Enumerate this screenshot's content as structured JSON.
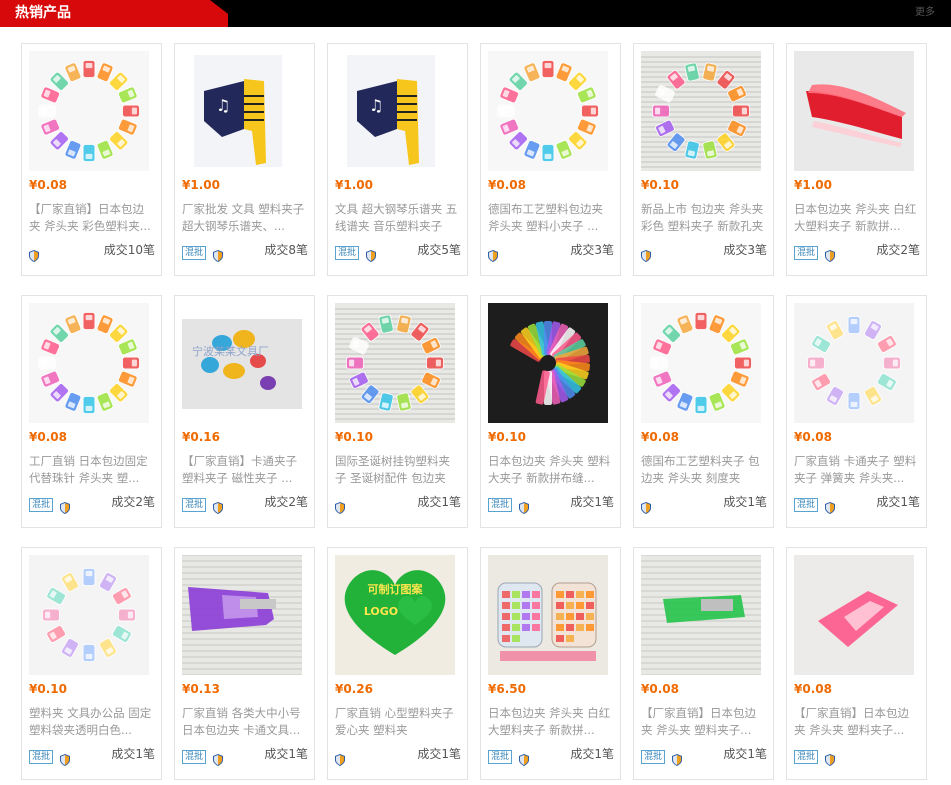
{
  "header": {
    "title": "热销产品",
    "more": "更多"
  },
  "items": [
    {
      "price": "¥0.08",
      "desc": "【厂家直销】日本包边夹 斧头夹 彩色塑料夹...",
      "mixed": false,
      "sold": "成交10笔",
      "img": "rainbow-ring"
    },
    {
      "price": "¥1.00",
      "desc": "厂家批发 文具 塑料夹子 超大钢琴乐谱夹、...",
      "mixed": true,
      "sold": "成交8笔",
      "img": "music-clip"
    },
    {
      "price": "¥1.00",
      "desc": "文具 超大钢琴乐谱夹 五线谱夹 音乐塑料夹子",
      "mixed": true,
      "sold": "成交5笔",
      "img": "music-clip"
    },
    {
      "price": "¥0.08",
      "desc": "德国布工艺塑料包边夹 斧头夹 塑料小夹子 ...",
      "mixed": false,
      "sold": "成交3笔",
      "img": "rainbow-ring"
    },
    {
      "price": "¥0.10",
      "desc": "新品上市 包边夹 斧头夹 彩色 塑料夹子 新款孔夹",
      "mixed": false,
      "sold": "成交3笔",
      "img": "newspaper-ring"
    },
    {
      "price": "¥1.00",
      "desc": "日本包边夹 斧头夹 白红大塑料夹子 新款拼...",
      "mixed": true,
      "sold": "成交2笔",
      "img": "red-clip"
    },
    {
      "price": "¥0.08",
      "desc": "工厂直销 日本包边固定代替珠针 斧头夹 塑...",
      "mixed": true,
      "sold": "成交2笔",
      "img": "rainbow-ring"
    },
    {
      "price": "¥0.16",
      "desc": "【厂家直销】卡通夹子 塑料夹子 磁性夹子 ...",
      "mixed": true,
      "sold": "成交2笔",
      "img": "cartoon"
    },
    {
      "price": "¥0.10",
      "desc": "国际圣诞树挂钩塑料夹子 圣诞树配件 包边夹",
      "mixed": false,
      "sold": "成交1笔",
      "img": "newspaper-ring"
    },
    {
      "price": "¥0.10",
      "desc": "日本包边夹 斧头夹 塑料大夹子 新款拼布缝...",
      "mixed": true,
      "sold": "成交1笔",
      "img": "fan-dark"
    },
    {
      "price": "¥0.08",
      "desc": "德国布工艺塑料夹子 包边夹 斧头夹 刻度夹",
      "mixed": false,
      "sold": "成交1笔",
      "img": "rainbow-ring"
    },
    {
      "price": "¥0.08",
      "desc": "厂家直销 卡通夹子 塑料夹子 弹簧夹 斧头夹...",
      "mixed": true,
      "sold": "成交1笔",
      "img": "pastel-ring"
    },
    {
      "price": "¥0.10",
      "desc": "塑料夹 文具办公品 固定塑料袋夹透明白色...",
      "mixed": true,
      "sold": "成交1笔",
      "img": "pastel-ring"
    },
    {
      "price": "¥0.13",
      "desc": "厂家直销 各类大中小号日本包边夹 卡通文具...",
      "mixed": true,
      "sold": "成交1笔",
      "img": "purple-clip"
    },
    {
      "price": "¥0.26",
      "desc": "厂家直销 心型塑料夹子 爱心夹 塑料夹",
      "mixed": false,
      "sold": "成交1笔",
      "img": "heart"
    },
    {
      "price": "¥6.50",
      "desc": "日本包边夹 斧头夹 白红大塑料夹子 新款拼...",
      "mixed": true,
      "sold": "成交1笔",
      "img": "jars"
    },
    {
      "price": "¥0.08",
      "desc": "【厂家直销】日本包边夹 斧头夹 塑料夹子...",
      "mixed": true,
      "sold": "成交1笔",
      "img": "green-clip"
    },
    {
      "price": "¥0.08",
      "desc": "【厂家直销】日本包边夹 斧头夹 塑料夹子...",
      "mixed": true,
      "sold": "",
      "img": "pink-clip"
    }
  ],
  "badges": {
    "mixed_label": "混批"
  },
  "colors": {
    "price": "#ef6a00",
    "header_bg": "#000000",
    "tab_bg": "#d8090a"
  },
  "heart_text": [
    "可制订图案",
    "LOGO"
  ],
  "cartoon_text": "宁波某某文具厂"
}
